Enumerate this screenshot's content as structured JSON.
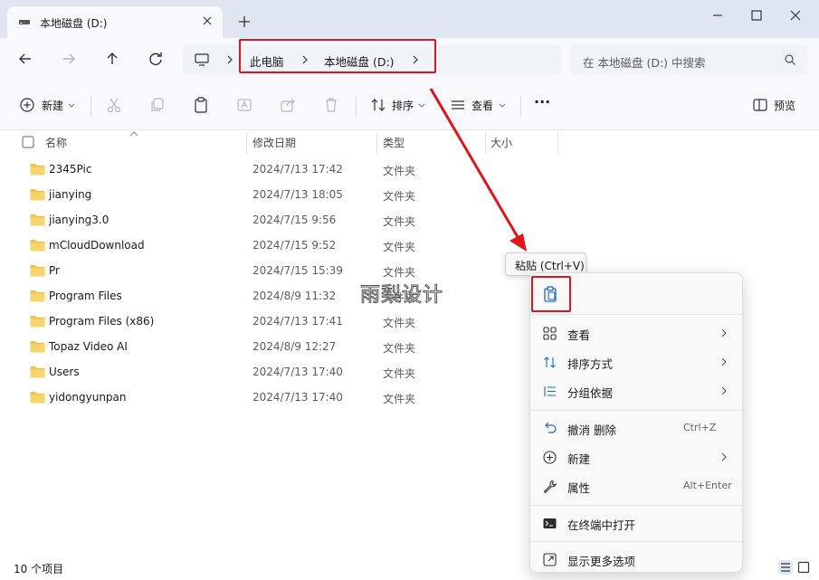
{
  "window": {
    "tab_title": "本地磁盘 (D:)",
    "tab_icon": "drive-icon",
    "controls": [
      "minimize-icon",
      "maximize-icon",
      "close-icon"
    ]
  },
  "address": {
    "crumbs": [
      "此电脑",
      "本地磁盘 (D:)"
    ]
  },
  "search": {
    "placeholder": "在 本地磁盘 (D:) 中搜索"
  },
  "toolbar": {
    "new_label": "新建",
    "sort_label": "排序",
    "view_label": "查看",
    "more_label": "···",
    "preview_label": "预览"
  },
  "columns": {
    "name": "名称",
    "date": "修改日期",
    "type": "类型",
    "size": "大小"
  },
  "files": [
    {
      "name": "2345Pic",
      "date": "2024/7/13 17:42",
      "type": "文件夹"
    },
    {
      "name": "jianying",
      "date": "2024/7/13 18:05",
      "type": "文件夹"
    },
    {
      "name": "jianying3.0",
      "date": "2024/7/15 9:56",
      "type": "文件夹"
    },
    {
      "name": "mCloudDownload",
      "date": "2024/7/15 9:52",
      "type": "文件夹"
    },
    {
      "name": "Pr",
      "date": "2024/7/15 15:39",
      "type": "文件夹"
    },
    {
      "name": "Program Files",
      "date": "2024/8/9 11:32",
      "type": "文件夹"
    },
    {
      "name": "Program Files (x86)",
      "date": "2024/7/13 17:41",
      "type": "文件夹"
    },
    {
      "name": "Topaz Video AI",
      "date": "2024/8/9 12:27",
      "type": "文件夹"
    },
    {
      "name": "Users",
      "date": "2024/7/13 17:40",
      "type": "文件夹"
    },
    {
      "name": "yidongyunpan",
      "date": "2024/7/13 17:40",
      "type": "文件夹"
    }
  ],
  "status": {
    "count": "10 个项目"
  },
  "watermark": "雨梨设计",
  "tooltip": "粘贴 (Ctrl+V)",
  "context_menu": {
    "paste_icon": "paste-icon",
    "items": [
      {
        "label": "查看",
        "icon": "grid-view-icon",
        "submenu": true
      },
      {
        "label": "排序方式",
        "icon": "sort-icon",
        "submenu": true
      },
      {
        "label": "分组依据",
        "icon": "group-icon",
        "submenu": true
      },
      {
        "label": "撤消 删除",
        "icon": "undo-icon",
        "shortcut": "Ctrl+Z"
      },
      {
        "label": "新建",
        "icon": "new-icon",
        "submenu": true
      },
      {
        "label": "属性",
        "icon": "wrench-icon",
        "shortcut": "Alt+Enter"
      },
      {
        "label": "在终端中打开",
        "icon": "terminal-icon"
      },
      {
        "label": "显示更多选项",
        "icon": "more-options-icon"
      }
    ]
  },
  "colors": {
    "highlight_red": "#e0141b",
    "folder_yellow": "#f2c14e",
    "accent_blue": "#1a6cc4"
  }
}
